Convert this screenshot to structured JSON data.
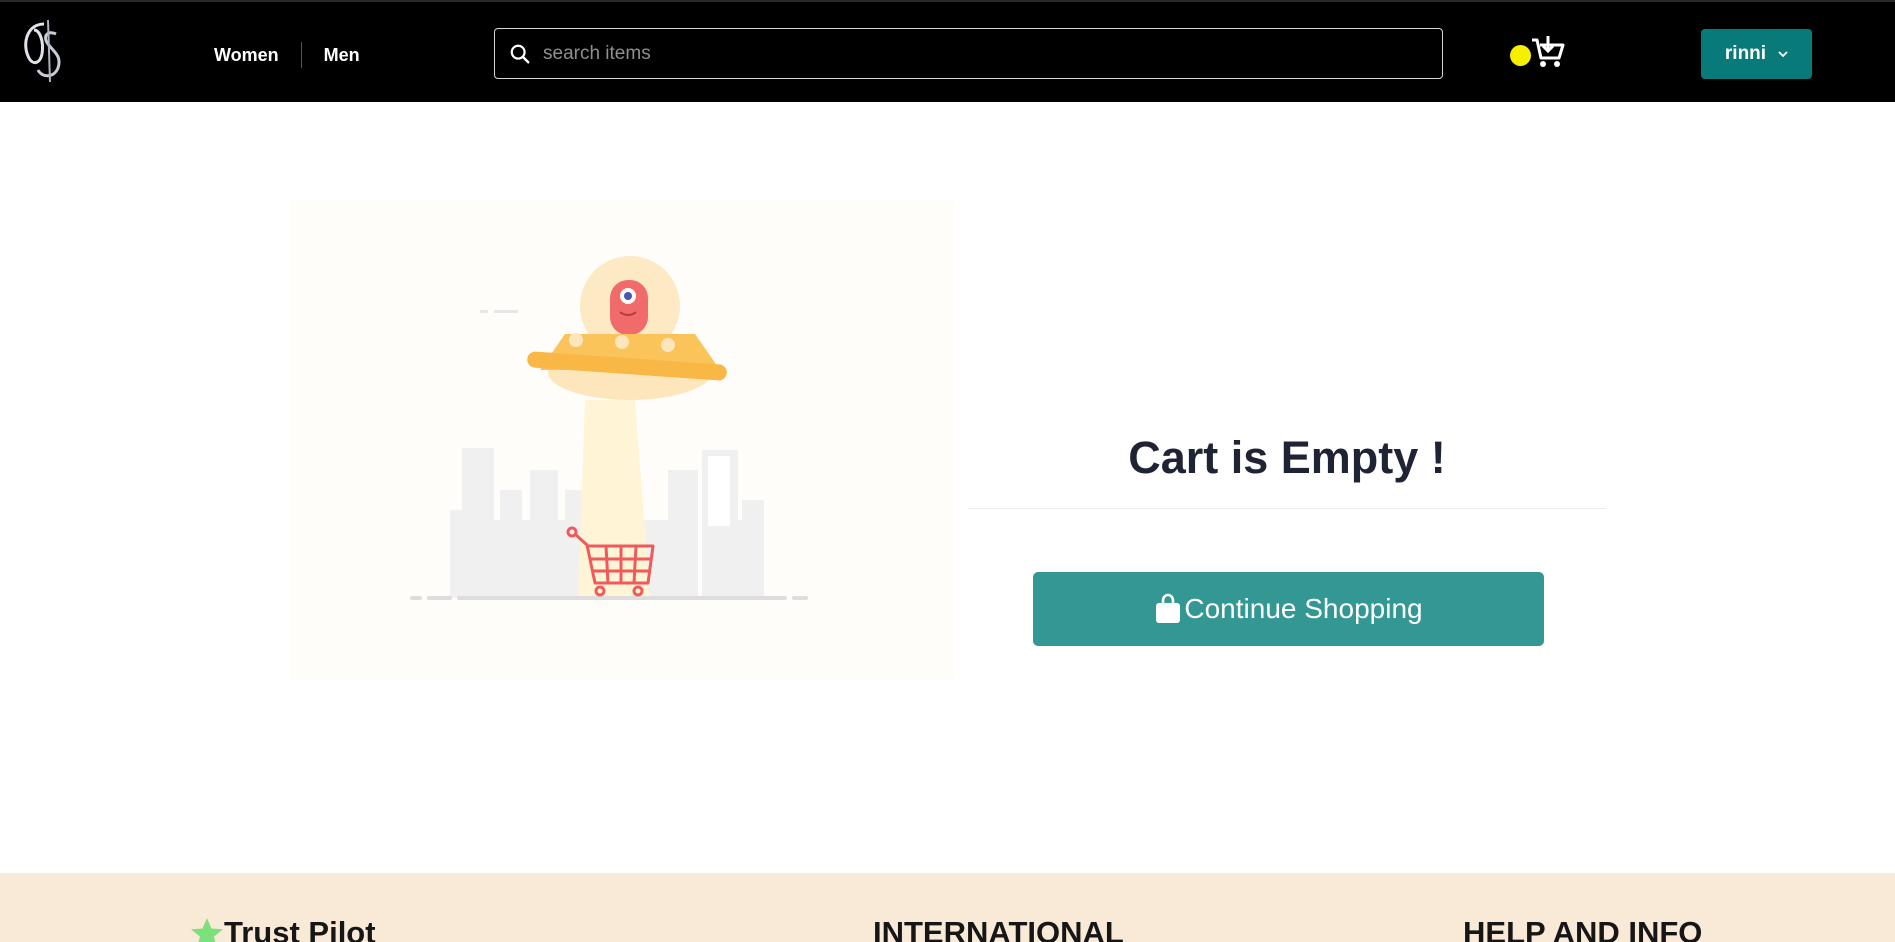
{
  "header": {
    "nav": [
      {
        "label": "Women"
      },
      {
        "label": "Men"
      }
    ],
    "search": {
      "placeholder": "search items",
      "value": ""
    },
    "user_label": "rinni",
    "cart_badge_color": "#f7ef00",
    "accent": "#087a7a"
  },
  "main": {
    "title": "Cart is Empty !",
    "continue_label": "Continue Shopping",
    "button_color": "#339894"
  },
  "footer": {
    "columns": [
      {
        "title": "Trust Pilot"
      },
      {
        "title": "INTERNATIONAL"
      },
      {
        "title": "HELP AND INFO"
      }
    ],
    "background": "#f9e9d7"
  },
  "icons": [
    "logo-icon",
    "search-icon",
    "cart-icon",
    "chevron-down-icon",
    "shopping-bag-icon",
    "star-icon",
    "ufo-illustration"
  ]
}
